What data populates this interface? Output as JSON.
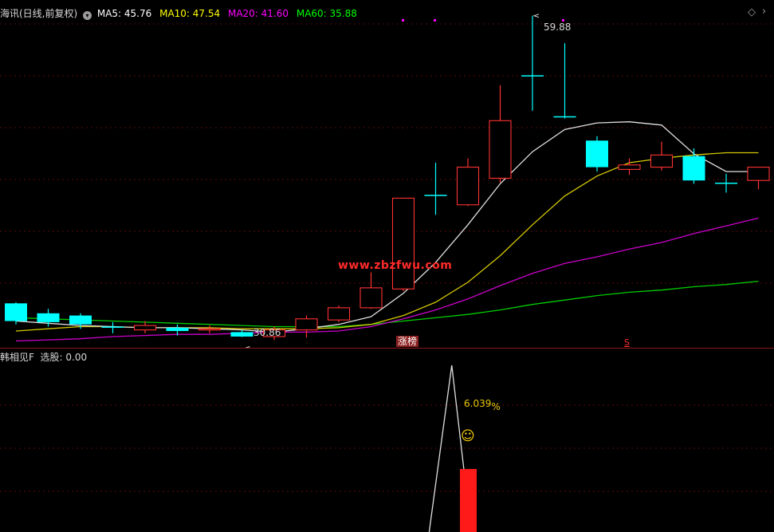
{
  "header": {
    "stock_name": "海讯(日线,前复权)",
    "ma5": "MA5: 45.76",
    "ma10": "MA10: 47.54",
    "ma20": "MA20: 41.60",
    "ma60": "MA60: 35.88",
    "ma5_color": "#ffffff",
    "ma10_color": "#ffff00",
    "ma20_color": "#ff00ff",
    "ma60_color": "#00ff00"
  },
  "annotations": {
    "high_label": "59.88",
    "low_label": "30.86",
    "limit_up_tag": "涨榜",
    "s_marker": "S",
    "watermark": "www.zbzfwu.com"
  },
  "indicator": {
    "title": "韩相见F  选股: 0.00",
    "value_label": "6.039",
    "percent_sign": "%",
    "smiley": "☺"
  },
  "chart_data": {
    "type": "candlestick",
    "candles": [
      {
        "o": 33.9,
        "c": 32.3,
        "h": 34.0,
        "l": 32.0
      },
      {
        "o": 33.0,
        "c": 32.2,
        "h": 33.4,
        "l": 31.8
      },
      {
        "o": 32.8,
        "c": 32.0,
        "h": 33.0,
        "l": 31.6
      },
      {
        "o": 31.8,
        "c": 31.7,
        "h": 32.2,
        "l": 31.2
      },
      {
        "o": 31.5,
        "c": 31.9,
        "h": 32.3,
        "l": 31.2
      },
      {
        "o": 31.7,
        "c": 31.4,
        "h": 32.0,
        "l": 31.0
      },
      {
        "o": 31.5,
        "c": 31.6,
        "h": 31.9,
        "l": 31.2
      },
      {
        "o": 31.3,
        "c": 30.9,
        "h": 31.5,
        "l": 30.86
      },
      {
        "o": 30.9,
        "c": 31.5,
        "h": 31.8,
        "l": 30.6
      },
      {
        "o": 31.5,
        "c": 32.5,
        "h": 32.8,
        "l": 30.8
      },
      {
        "o": 32.4,
        "c": 33.5,
        "h": 33.7,
        "l": 32.2
      },
      {
        "o": 33.5,
        "c": 35.3,
        "h": 36.7,
        "l": 33.4
      },
      {
        "o": 35.2,
        "c": 43.4,
        "h": 43.4,
        "l": 35.0
      },
      {
        "o": 43.7,
        "c": 43.6,
        "h": 46.6,
        "l": 41.9
      },
      {
        "o": 42.8,
        "c": 46.2,
        "h": 47.0,
        "l": 42.7
      },
      {
        "o": 45.2,
        "c": 50.4,
        "h": 53.6,
        "l": 44.8
      },
      {
        "o": 54.5,
        "c": 54.4,
        "h": 59.88,
        "l": 51.3
      },
      {
        "o": 50.8,
        "c": 50.7,
        "h": 57.4,
        "l": 50.6
      },
      {
        "o": 48.6,
        "c": 46.2,
        "h": 49.0,
        "l": 45.8
      },
      {
        "o": 46.0,
        "c": 46.4,
        "h": 47.0,
        "l": 45.5
      },
      {
        "o": 46.2,
        "c": 47.3,
        "h": 48.5,
        "l": 45.9
      },
      {
        "o": 47.2,
        "c": 45.0,
        "h": 47.9,
        "l": 44.7
      },
      {
        "o": 44.8,
        "c": 44.7,
        "h": 45.6,
        "l": 43.9
      },
      {
        "o": 45.0,
        "c": 46.2,
        "h": 46.2,
        "l": 44.2
      }
    ],
    "ma5": [
      32.3,
      32.1,
      31.9,
      31.8,
      31.7,
      31.7,
      31.6,
      31.5,
      31.3,
      31.6,
      32.0,
      32.7,
      34.8,
      37.6,
      41.0,
      44.7,
      47.6,
      49.6,
      50.2,
      50.3,
      50.0,
      47.4,
      45.8,
      45.8
    ],
    "ma10": [
      31.4,
      31.6,
      31.8,
      31.8,
      31.7,
      31.7,
      31.7,
      31.6,
      31.6,
      31.6,
      31.7,
      32.0,
      32.8,
      34.0,
      35.8,
      38.2,
      41.0,
      43.6,
      45.4,
      46.6,
      47.0,
      47.3,
      47.5,
      47.5
    ],
    "ma20": [
      30.5,
      30.6,
      30.7,
      30.9,
      31.0,
      31.1,
      31.1,
      31.2,
      31.3,
      31.3,
      31.4,
      31.8,
      32.5,
      33.3,
      34.3,
      35.5,
      36.6,
      37.5,
      38.1,
      38.8,
      39.4,
      40.2,
      40.9,
      41.6
    ],
    "ma60": [
      32.6,
      32.5,
      32.4,
      32.3,
      32.2,
      32.1,
      32.0,
      31.9,
      31.8,
      31.8,
      31.8,
      32.0,
      32.3,
      32.6,
      32.9,
      33.3,
      33.8,
      34.2,
      34.6,
      34.9,
      35.1,
      35.4,
      35.6,
      35.9
    ],
    "indicator_line": {
      "x": [
        12.8,
        13.5,
        14.1
      ],
      "y": [
        0,
        1,
        0
      ]
    },
    "indicator_bar": {
      "index": 14,
      "value": 6.039
    },
    "ylim": [
      29.6,
      61.3
    ]
  }
}
